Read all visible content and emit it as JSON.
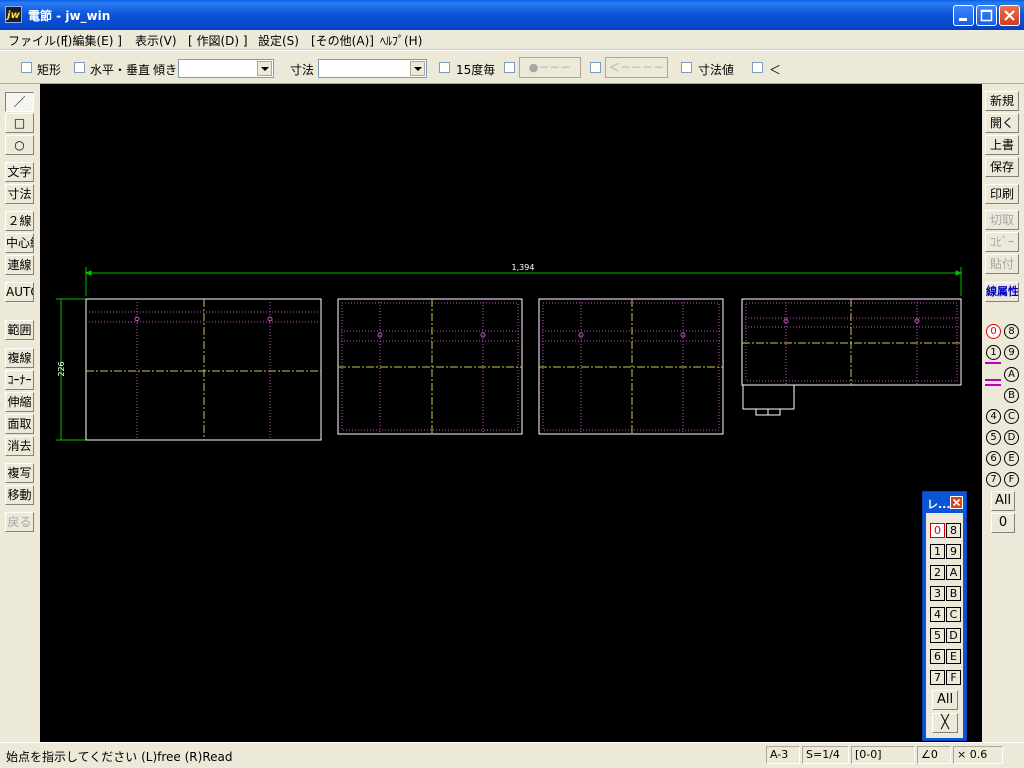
{
  "window": {
    "icon_text": "jw",
    "title": "電節 - jw_win"
  },
  "menu": [
    "ファイル(F)",
    "[ 編集(E) ]",
    "表示(V)",
    "[ 作図(D) ]",
    "設定(S)",
    "[その他(A)]",
    "ﾍﾙﾌﾟ(H)"
  ],
  "options": {
    "rect_label": "矩形",
    "hv_label": "水平・垂直",
    "tilt_label": "傾き",
    "tilt_value": "",
    "dim_label": "寸法",
    "dim_value": "",
    "deg15_label": "15度毎",
    "btn_dot": "●－－－",
    "btn_arrow": "＜－－－－",
    "dimval_label": "寸法値",
    "lt_label": "＜"
  },
  "left_tools": [
    "／",
    "□",
    "○",
    "文字",
    "寸法",
    "２線",
    "中心線",
    "連線",
    "AUTO",
    "範囲",
    "複線",
    "ｺｰﾅｰ",
    "伸縮",
    "面取",
    "消去",
    "複写",
    "移動",
    "戻る"
  ],
  "right_tools": [
    "新規",
    "開く",
    "上書",
    "保存",
    "印刷",
    "切取",
    "ｺﾋﾟｰ",
    "貼付",
    "線属性"
  ],
  "right_layers": [
    "0",
    "8",
    "1",
    "9",
    "",
    "A",
    "",
    "B",
    "4",
    "C",
    "5",
    "D",
    "6",
    "E",
    "7",
    "F"
  ],
  "right_all": "All",
  "right_zero": "0",
  "drawing": {
    "dim_top": "1,394",
    "dim_left": "226"
  },
  "palette": {
    "title": "レ...",
    "layers": [
      "0",
      "8",
      "1",
      "9",
      "2",
      "A",
      "3",
      "B",
      "4",
      "C",
      "5",
      "D",
      "6",
      "E",
      "7",
      "F"
    ],
    "all": "All",
    "x": "╳"
  },
  "status": {
    "message": "始点を指示してください (L)free (R)Read",
    "paper": "A-3",
    "scale": "S=1/4",
    "layer": "[0-0]",
    "angle": "∠0",
    "zoom": "× 0.6"
  },
  "colors": {
    "canvas": "#000000",
    "outline": "#ffffff",
    "dim": "#00c000",
    "center": "#c8c850",
    "hidden": "#c050c0"
  }
}
